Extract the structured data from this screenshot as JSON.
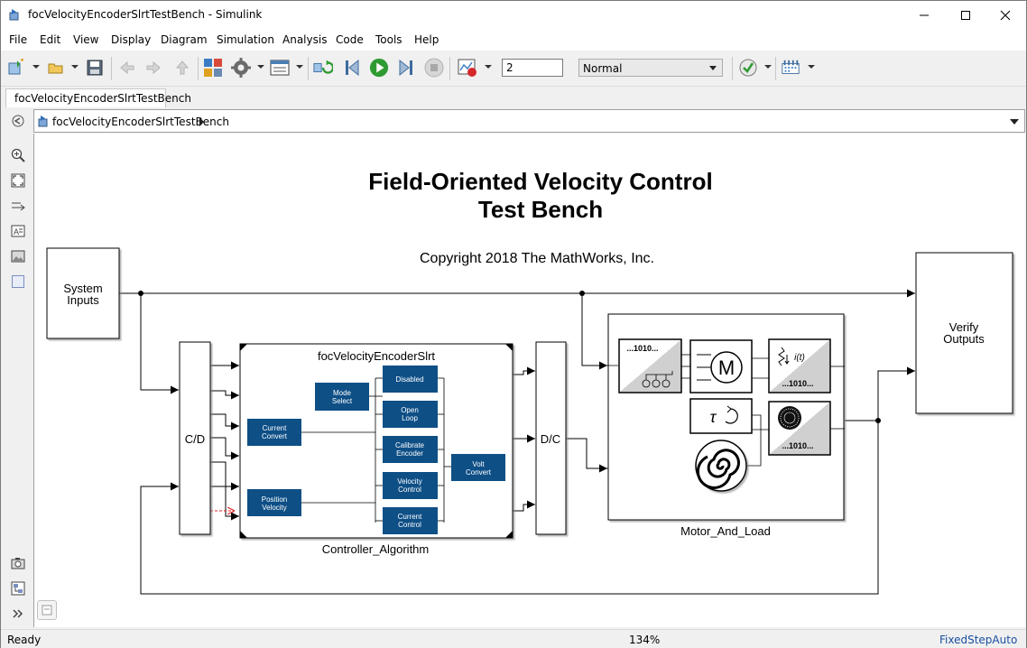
{
  "window": {
    "title": "focVelocityEncoderSlrtTestBench - Simulink",
    "minimize_icon": "minimize-icon",
    "maximize_icon": "maximize-icon",
    "close_icon": "close-icon"
  },
  "menu": {
    "items": [
      "File",
      "Edit",
      "View",
      "Display",
      "Diagram",
      "Simulation",
      "Analysis",
      "Code",
      "Tools",
      "Help"
    ]
  },
  "toolbar": {
    "stop_time": "2",
    "sim_mode": "Normal",
    "icons": [
      "new-model-icon",
      "open-icon",
      "save-icon",
      "back-icon",
      "forward-icon",
      "up-icon",
      "library-browser-icon",
      "model-config-icon",
      "model-explorer-icon",
      "update-diagram-icon",
      "step-back-icon",
      "run-icon",
      "step-forward-icon",
      "stop-icon",
      "record-icon",
      "model-advisor-icon",
      "data-inspector-icon"
    ]
  },
  "tab": {
    "label": "focVelocityEncoderSlrtTestBench"
  },
  "breadcrumb": {
    "label": "focVelocityEncoderSlrtTestBench"
  },
  "diagram": {
    "title_line1": "Field-Oriented Velocity Control",
    "title_line2": "Test Bench",
    "copyright": "Copyright 2018 The MathWorks, Inc.",
    "system_inputs": [
      "System",
      "Inputs"
    ],
    "verify_outputs": [
      "Verify",
      "Outputs"
    ],
    "cd_label": "C/D",
    "dc_label": "D/C",
    "controller_title": "focVelocityEncoderSlrt",
    "controller_name": "Controller_Algorithm",
    "motor_name": "Motor_And_Load",
    "inner_blocks": {
      "mode_select": [
        "Mode",
        "Select"
      ],
      "disabled": [
        "Disabled"
      ],
      "open_loop": [
        "Open",
        "Loop"
      ],
      "calibrate_encoder": [
        "Calibrate",
        "Encoder"
      ],
      "velocity_control": [
        "Velocity",
        "Control"
      ],
      "current_control": [
        "Current",
        "Control"
      ],
      "current_convert": [
        "Current",
        "Convert"
      ],
      "position_velocity": [
        "Position",
        "Velocity"
      ],
      "volt_convert": [
        "Volt",
        "Convert"
      ]
    },
    "motor_blocks": {
      "inverter_label": "...1010...",
      "sensor_label": "...1010...",
      "encoder_label": "...1010...",
      "motor_letter": "M",
      "current_label": "i(t)",
      "tau_label": "τ"
    }
  },
  "status": {
    "left": "Ready",
    "zoom": "134%",
    "solver": "FixedStepAuto"
  },
  "colors": {
    "block_blue": "#0e4f86",
    "chrome": "#f0f0f0",
    "run_green": "#2e9b32"
  }
}
